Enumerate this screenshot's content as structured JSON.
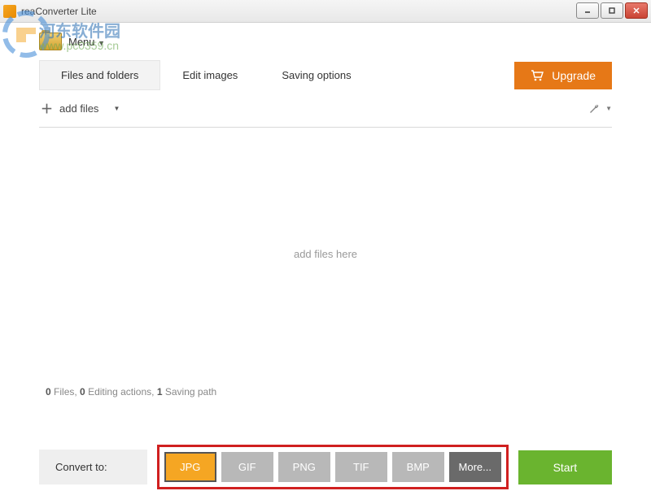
{
  "window": {
    "title": "reaConverter Lite"
  },
  "watermark": {
    "text": "河东软件园",
    "url": "www.pc0359.cn"
  },
  "menu": {
    "label": "Menu"
  },
  "tabs": {
    "files": "Files and folders",
    "edit": "Edit images",
    "saving": "Saving options"
  },
  "upgrade": {
    "label": "Upgrade"
  },
  "toolbar": {
    "add_files": "add files"
  },
  "drop": {
    "placeholder": "add files here"
  },
  "status": {
    "files_count": "0",
    "files_label": "Files,",
    "actions_count": "0",
    "actions_label": "Editing actions,",
    "paths_count": "1",
    "paths_label": "Saving path"
  },
  "convert": {
    "label": "Convert to:",
    "formats": {
      "jpg": "JPG",
      "gif": "GIF",
      "png": "PNG",
      "tif": "TIF",
      "bmp": "BMP",
      "more": "More..."
    }
  },
  "start": {
    "label": "Start"
  }
}
